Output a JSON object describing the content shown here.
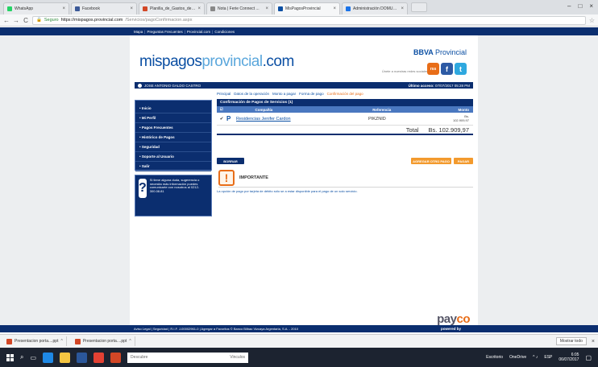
{
  "browser": {
    "tabs": [
      {
        "title": "WhatsApp",
        "color": "#25d366"
      },
      {
        "title": "Facebook",
        "color": "#3b5998"
      },
      {
        "title": "Planilla_de_Gastos_de_C...",
        "color": "#d24726"
      },
      {
        "title": "Nota | Ferie Connect ...",
        "color": "#888888"
      },
      {
        "title": "MisPagosProvincial",
        "color": "#0b4fa3"
      },
      {
        "title": "Administración DOMUS ...",
        "color": "#1a73e8"
      }
    ],
    "window_controls": [
      "–",
      "□",
      "×"
    ],
    "back": "←",
    "forward": "→",
    "reload": "C",
    "url_security": "Seguro",
    "url_host": "https://mispagos.provincial.com",
    "url_path": "/Servicios/pagoConfirmacion.aspx",
    "bookmark": "☆"
  },
  "topnav": {
    "items": [
      "Mapa",
      "Preguntas Frecuentes",
      "Provincial.com",
      "Condiciones"
    ]
  },
  "site": {
    "logo_main": "mispagos",
    "logo_accent": "provincial",
    "logo_suffix": ".com",
    "bank_bold": "BBVA",
    "bank_name": "Provincial",
    "social_label": "Únete a nuestras redes sociales",
    "social": [
      "rss",
      "f",
      "t"
    ]
  },
  "userbar": {
    "name": "JOSE ANTONIO GALDO CASTRO",
    "last_access_label": "Último acceso:",
    "last_access": "07/07/2017 05:28 PM"
  },
  "sidebar": {
    "items": [
      "Inicio",
      "Mi Perfil",
      "Pagos Frecuentes",
      "Histórico de Pagos",
      "Seguridad",
      "Soporte al Usuario",
      "Salir"
    ]
  },
  "help": {
    "icon": "?",
    "text": "Si tiene alguna duda, sugerencia o necesita más información puedes comunicarte con nosotros al 0212-300.08.81"
  },
  "steps": [
    "Principal",
    "Datos de la operación",
    "Monto a pagar",
    "Forma de pago",
    "Confirmación del pago"
  ],
  "panel": {
    "title": "Confirmación de Pagos de Servicios (1)",
    "headers": {
      "check": "☑",
      "company": "Compañía",
      "reference": "Referencia",
      "amount": "Monto"
    },
    "rows": [
      {
        "check": "✔",
        "icon": "P",
        "company": "Residencias Jenifer Cardon",
        "reference": "PIKZNID",
        "currency": "Bs.",
        "amount": "102.909,97"
      }
    ],
    "total_label": "Total",
    "total_value": "Bs. 102.909,97"
  },
  "buttons": {
    "back": "BORRAR",
    "more": "AGREGAR OTRO PAGO",
    "pay": "PAGAR"
  },
  "important": {
    "icon": "!",
    "title": "IMPORTANTE",
    "text": "La opción de pago por tarjeta de débito sólo se a estar disponible para el pago de un solo servicio."
  },
  "brand_footer": {
    "pay": "pay",
    "co": "co",
    "powered": "powered by"
  },
  "footer": {
    "text": "Aviso Legal | Seguridad | R.I.F. J-00002961-0 | Agregar a Favoritos © Banco Bilbao Vizcaya Argentaria, S.A. - 2010"
  },
  "downloads": {
    "items": [
      "Presentacion porta....ppt",
      "Presentacion porta....ppt"
    ],
    "show_all": "Mostrar todo",
    "close": "×"
  },
  "taskbar": {
    "search": "Descubre",
    "search_end": "Vinculos",
    "app_label": "Escritorio",
    "onedrive": "OneDrive",
    "time": "6:05",
    "date": "06/07/2017",
    "lang": "ESP"
  }
}
